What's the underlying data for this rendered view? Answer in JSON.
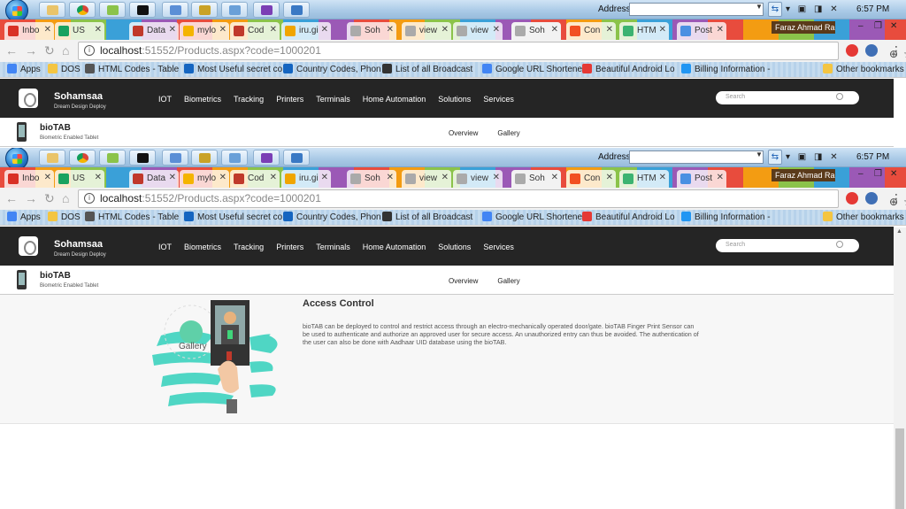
{
  "taskbar": {
    "address_label": "Address",
    "clock": "6:57 PM"
  },
  "tabs": [
    {
      "label": "Inbo",
      "color": "#d93025"
    },
    {
      "label": "US",
      "color": "#1aa260"
    },
    {
      "label": "Data",
      "color": "#c0392b"
    },
    {
      "label": "mylo",
      "color": "#f4b400"
    },
    {
      "label": "Cod",
      "color": "#c0392b"
    },
    {
      "label": "iru.gi",
      "color": "#f0a500"
    },
    {
      "label": "Soh",
      "color": "#aaaaaa"
    },
    {
      "label": "view",
      "color": "#aaaaaa"
    },
    {
      "label": "view",
      "color": "#aaaaaa"
    },
    {
      "label": "Soh",
      "color": "#aaaaaa"
    },
    {
      "label": "Con",
      "color": "#f25022"
    },
    {
      "label": "HTM",
      "color": "#3cb371"
    },
    {
      "label": "Post",
      "color": "#4a90e2"
    }
  ],
  "profile_name": "Faraz Ahmad Ra...",
  "omnibox": {
    "host": "localhost",
    "rest": ":51552/Products.aspx?code=1000201"
  },
  "bookmarks": [
    {
      "label": "Apps",
      "color": "#4285f4"
    },
    {
      "label": "DOS",
      "color": "#f4c542"
    },
    {
      "label": "HTML Codes - Table",
      "color": "#555555"
    },
    {
      "label": "Most Useful secret co",
      "color": "#1565c0"
    },
    {
      "label": "Country Codes, Phon",
      "color": "#1565c0"
    },
    {
      "label": "List of all Broadcast",
      "color": "#333333"
    },
    {
      "label": "Google URL Shortene",
      "color": "#4285f4"
    },
    {
      "label": "Beautiful Android Lo",
      "color": "#e53935"
    },
    {
      "label": "Billing Information -",
      "color": "#2196f3"
    },
    {
      "label": "Other bookmarks",
      "color": "#f4c542"
    }
  ],
  "site": {
    "brand": "Sohamsaa",
    "tagline": "Dream Design Deploy",
    "nav": [
      "IOT",
      "Biometrics",
      "Tracking",
      "Printers",
      "Terminals",
      "Home Automation",
      "Solutions",
      "Services"
    ],
    "search_placeholder": "Search"
  },
  "product": {
    "name": "bioTAB",
    "subtitle": "Biometric Enabled Tablet",
    "tabs": [
      "Overview",
      "Gallery"
    ]
  },
  "section": {
    "title": "Access Control",
    "description": "bioTAB can be deployed to control and restrict access through an electro-mechanically operated door/gate. bioTAB Finger Print Sensor can be used to authenticate and authorize an approved user for secure access. An unauthorized entry can thus be avoided. The authentication of the user can also be done with Aadhaar UID database using the bioTAB."
  },
  "gallery_heading": "Gallery"
}
